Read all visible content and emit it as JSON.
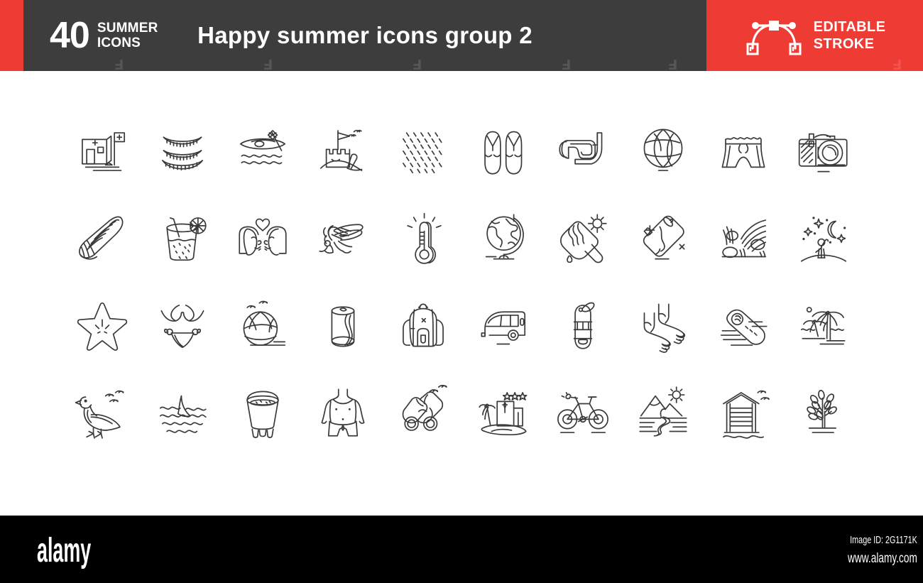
{
  "header": {
    "count_number": "40",
    "count_line1": "SUMMER",
    "count_line2": "ICONS",
    "title": "Happy summer icons group 2",
    "badge_line1": "EDITABLE",
    "badge_line2": "STROKE",
    "badge_icon": "bezier-curve-icon",
    "colors": {
      "red": "#ee3b33",
      "dark": "#3d3d3d",
      "white": "#ffffff"
    }
  },
  "grid": {
    "columns": 10,
    "rows": 4,
    "stroke_color": "#3a3a3c",
    "icons": [
      {
        "name": "lifeguard-station-icon",
        "label": "Lifeguard station"
      },
      {
        "name": "watermelon-slices-icon",
        "label": "Watermelon slices"
      },
      {
        "name": "kayak-icon",
        "label": "Kayak"
      },
      {
        "name": "sandcastle-icon",
        "label": "Sandcastle"
      },
      {
        "name": "sand-texture-icon",
        "label": "Sand"
      },
      {
        "name": "flip-flops-icon",
        "label": "Flip flops"
      },
      {
        "name": "snorkel-mask-icon",
        "label": "Snorkel mask"
      },
      {
        "name": "beach-volleyball-icon",
        "label": "Volleyball"
      },
      {
        "name": "swim-shorts-icon",
        "label": "Swim shorts"
      },
      {
        "name": "photo-camera-icon",
        "label": "Photo camera"
      },
      {
        "name": "seashell-icon",
        "label": "Seashell"
      },
      {
        "name": "cocktail-drink-icon",
        "label": "Cocktail drink"
      },
      {
        "name": "couple-kissing-icon",
        "label": "Couple kissing"
      },
      {
        "name": "mosquito-icon",
        "label": "Mosquito"
      },
      {
        "name": "thermometer-icon",
        "label": "Thermometer"
      },
      {
        "name": "globe-icon",
        "label": "Globe"
      },
      {
        "name": "ice-cream-bar-icon",
        "label": "Ice cream bar"
      },
      {
        "name": "cold-drink-can-icon",
        "label": "Cold drink can"
      },
      {
        "name": "beach-waves-icon",
        "label": "Beach waves"
      },
      {
        "name": "stargazing-icon",
        "label": "Stargazing at night"
      },
      {
        "name": "starfish-icon",
        "label": "Starfish"
      },
      {
        "name": "bikini-icon",
        "label": "Bikini"
      },
      {
        "name": "beach-ball-icon",
        "label": "Beach ball"
      },
      {
        "name": "soda-can-icon",
        "label": "Soda can"
      },
      {
        "name": "backpack-icon",
        "label": "Backpack"
      },
      {
        "name": "caravan-icon",
        "label": "Caravan"
      },
      {
        "name": "buoy-icon",
        "label": "Buoy"
      },
      {
        "name": "bare-feet-icon",
        "label": "Bare feet"
      },
      {
        "name": "bodyboard-icon",
        "label": "Bodyboard"
      },
      {
        "name": "palm-trees-icon",
        "label": "Palm trees"
      },
      {
        "name": "seagull-icon",
        "label": "Seagull"
      },
      {
        "name": "shark-fin-icon",
        "label": "Shark fin"
      },
      {
        "name": "sand-bucket-icon",
        "label": "Sand bucket"
      },
      {
        "name": "suntanned-torso-icon",
        "label": "Suntanned torso"
      },
      {
        "name": "binoculars-icon",
        "label": "Binoculars"
      },
      {
        "name": "hotel-resort-icon",
        "label": "Hotel resort"
      },
      {
        "name": "bicycle-icon",
        "label": "Bicycle"
      },
      {
        "name": "mountain-river-icon",
        "label": "Mountain river"
      },
      {
        "name": "beach-hut-icon",
        "label": "Beach hut"
      },
      {
        "name": "young-tree-icon",
        "label": "Young tree"
      }
    ]
  },
  "footer": {
    "logo": "alamy",
    "image_id": "Image ID: 2G1171K",
    "url": "www.alamy.com"
  }
}
